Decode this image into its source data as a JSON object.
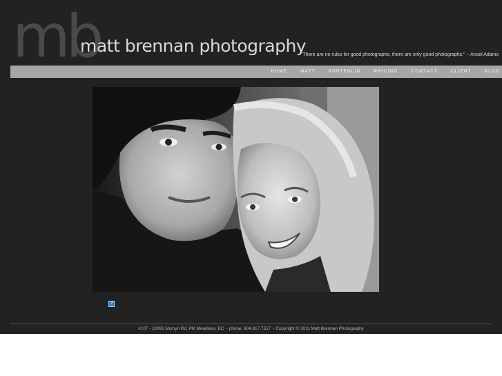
{
  "header": {
    "logo_mark": "mb",
    "logo_text": "matt brennan photography",
    "quote": "\"There are no rules for good photographs, there are only good photographs.\" ~ Ansel Adams"
  },
  "nav": {
    "items": [
      {
        "label": "HOME"
      },
      {
        "label": "MATT"
      },
      {
        "label": "PORTFOLIO"
      },
      {
        "label": "PRICING"
      },
      {
        "label": "CONTACT"
      },
      {
        "label": "CLIENT"
      },
      {
        "label": "BLOG"
      }
    ]
  },
  "main": {
    "photo": "black-and-white portrait of a smiling couple",
    "badge_icon": "broken-plugin-icon",
    "badge_glyph": "?"
  },
  "footer": {
    "text": "#107 - 19091 Mcmyn Rd, Pitt Meadows, BC ~ phone: 604.817.7517 ~ Copyright © 2011 Matt Brennan Photography"
  },
  "colors": {
    "background": "#222222",
    "navbar": "#a6a6a6",
    "logo_mark": "#4a4a4a",
    "logo_text": "#d9d9d9"
  }
}
